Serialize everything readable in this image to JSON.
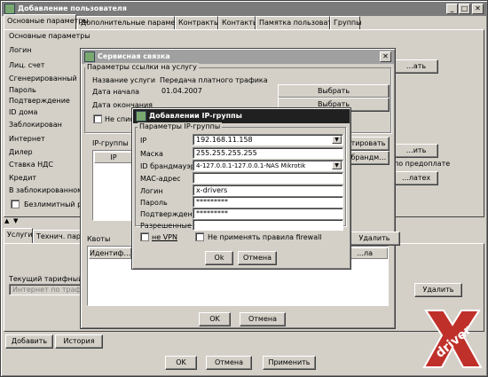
{
  "main": {
    "title": "Добавление пользователя",
    "tabs": [
      "Основные параметры",
      "Дополнительные параметры",
      "Контракты",
      "Контакты",
      "Памятка пользователя",
      "Группы"
    ],
    "group_title": "Основные параметры",
    "fields": [
      "Логин",
      "Лиц. счет",
      "Сгенерированный пароль",
      "Пароль",
      "Подтверждение",
      "ID дома",
      "Заблокирован",
      "Интернет",
      "Дилер",
      "Ставка НДС",
      "Кредит",
      "В заблокированном состоянии"
    ],
    "right_buttons": [
      "…ать",
      "…ить",
      "…латех"
    ],
    "right_label": "по предоплате",
    "unlimited_label": "Безлимитный режим",
    "lower_tabs": [
      "Услуги",
      "Технич. параметры"
    ],
    "tariff_label": "Текущий тарифный план",
    "tariff_placeholder": "Интернет по трафику",
    "delete_label": "Удалить",
    "add_label": "Добавить",
    "history_label": "История",
    "ok_label": "OK",
    "cancel_label": "Отмена",
    "apply_label": "Применить"
  },
  "service": {
    "title": "Сервисная связка",
    "group_title": "Параметры ссылки на услугу",
    "service_name_label": "Название услуги",
    "service_name_value": "Передача платного трафика",
    "start_label": "Дата начала",
    "start_value": "01.04.2007",
    "end_label": "Дата окончания",
    "select_label": "Выбрать",
    "no_list_label": "Не спис…",
    "ip_groups_label": "IP-группы",
    "ip_col": "IP",
    "right_btn1": "…тировать",
    "right_btn2": "D брандм…",
    "quotas_label": "Квоты",
    "quota_col": "Идентиф…",
    "quota_col2": "…ла",
    "delete_label": "Удалить",
    "ok_label": "OK",
    "cancel_label": "Отмена"
  },
  "ipgroup": {
    "title": "Добавлении IP-группы",
    "group_title": "Параметры IP-группы",
    "ip_label": "IP",
    "ip_value": "192.168.11.158",
    "mask_label": "Маска",
    "mask_value": "255.255.255.255",
    "fw_label": "ID брандмауэра",
    "fw_value": "4-127.0.0.1-127.0.0.1-NAS Mikrotik",
    "mac_label": "MAC-адрес",
    "mac_value": "",
    "login_label": "Логин",
    "login_value": "x-drivers",
    "password_label": "Пароль",
    "password_value": "*********",
    "confirm_label": "Подтверждение",
    "confirm_value": "*********",
    "cid_label": "Разрешенные CID",
    "cid_value": "",
    "not_vpn_label": "не VPN",
    "no_fw_label": "Не применять правила firewall",
    "ok_label": "Ok",
    "cancel_label": "Отмена"
  },
  "watermark": "driver"
}
